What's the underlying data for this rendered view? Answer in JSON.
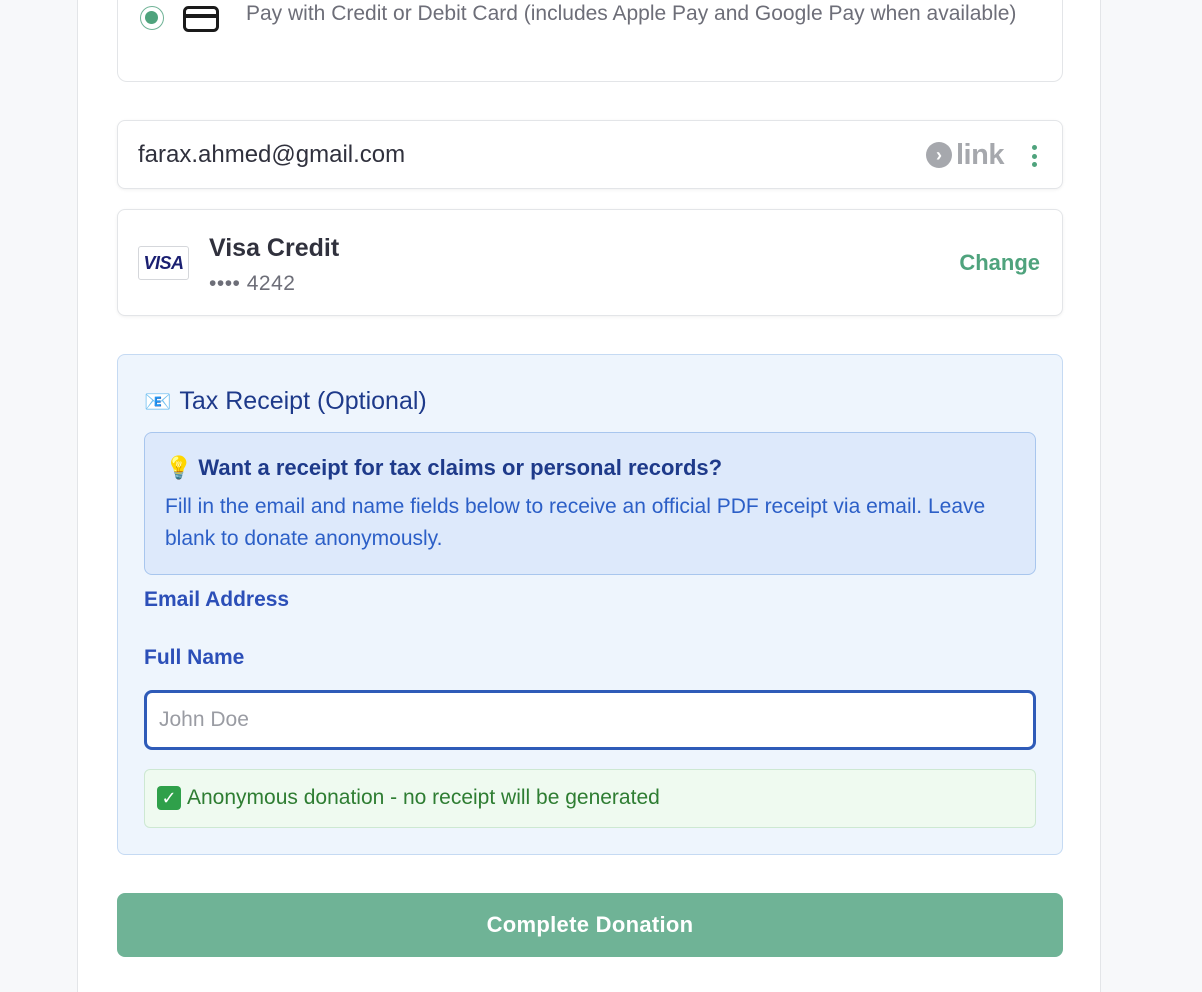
{
  "payment_option": {
    "label": "Pay with Credit or Debit Card (includes Apple Pay and Google Pay when available)",
    "selected": true,
    "icon": "credit-card-icon"
  },
  "link": {
    "email": "farax.ahmed@gmail.com",
    "logo_text": "link",
    "menu_icon": "kebab-menu-icon"
  },
  "card": {
    "logo_text": "VISA",
    "brand": "Visa Credit",
    "number": "•••• 4242",
    "change_label": "Change"
  },
  "tax_receipt": {
    "icon": "📧",
    "title": "Tax Receipt (Optional)",
    "info": {
      "icon": "💡",
      "heading": "Want a receipt for tax claims or personal records?",
      "body": "Fill in the email and name fields below to receive an official PDF receipt via email. Leave blank to donate anonymously."
    },
    "email_label": "Email Address",
    "name_label": "Full Name",
    "name_placeholder": "John Doe",
    "name_value": "",
    "anonymous_note": "Anonymous donation - no receipt will be generated",
    "anonymous_icon": "✓"
  },
  "submit_label": "Complete Donation",
  "colors": {
    "accent": "#4fa37d",
    "button": "#6fb396",
    "tax_title": "#1e3a8a",
    "info_text": "#2c5fc7",
    "success": "#2e7d32"
  }
}
